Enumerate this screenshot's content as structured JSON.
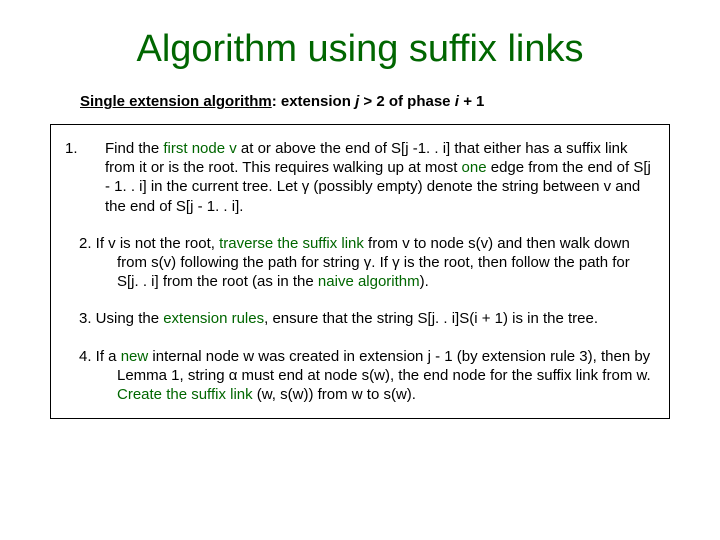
{
  "title": "Algorithm using suffix links",
  "subhead": {
    "label": "Single extension algorithm",
    "sep": ": extension ",
    "j": "j",
    "gt": " > 2 of phase ",
    "i": "i + ",
    "one": "1"
  },
  "steps": {
    "s1": {
      "num": "1.",
      "a": "Find the ",
      "b": "first node v",
      "c": " at or above the end of S[j -1. . i] that either has a suffix link from it or is the root. This requires walking up at most ",
      "d": "one",
      "e": " edge from the end of S[j - 1. . i] in the current tree. Let γ (possibly empty) denote the string between v and the end of S[j - 1. . i]."
    },
    "s2": {
      "a": "2. If v is not the root, ",
      "b": "traverse the suffix link",
      "c": " from v to node s(v) and then walk down from s(v) following the path for string γ. If γ is the root, then follow the path for S[j. . i] from the root (as in the ",
      "d": "naive algorithm",
      "e": ")."
    },
    "s3": {
      "a": "3. Using the ",
      "b": "extension rules",
      "c": ", ensure that the string S[j. . i]S(i + 1) is in the tree."
    },
    "s4": {
      "a": "4. If a ",
      "b": "new",
      "c": " internal node w was created in extension j - 1 (by extension rule 3), then by Lemma 1, string α must end at node s(w), the end node for the suffix link from w. ",
      "d": "Create the suffix link",
      "e": " (w, s(w)) from w to s(w)."
    }
  }
}
